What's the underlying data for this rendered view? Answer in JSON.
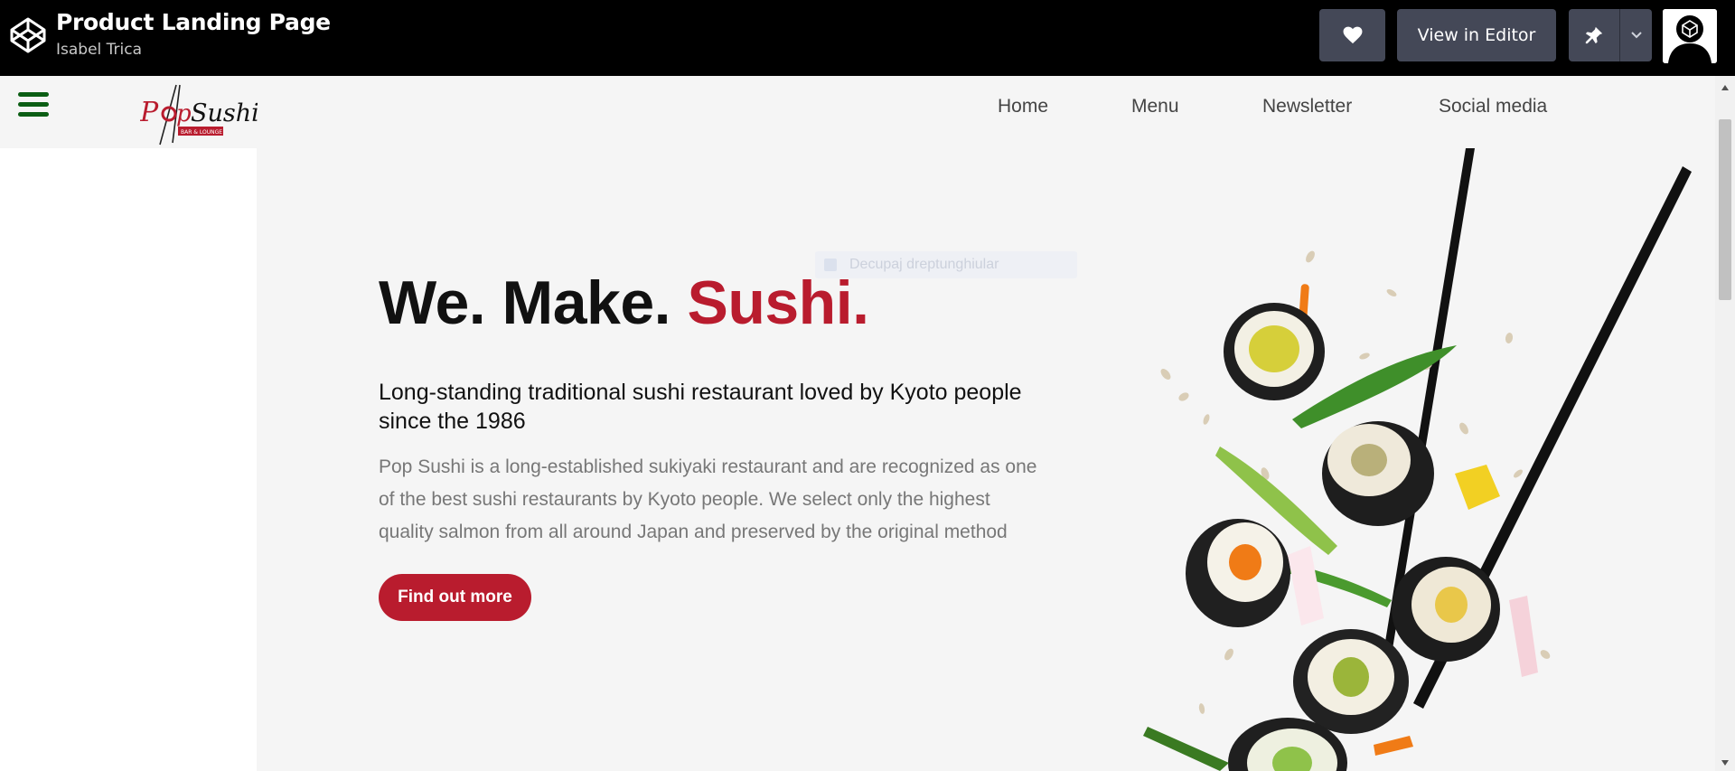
{
  "topbar": {
    "title": "Product Landing Page",
    "author": "Isabel Trica",
    "view_in_editor": "View in Editor",
    "icons": [
      "codepen-logo-icon",
      "heart-icon",
      "pin-icon",
      "chevron-down-icon",
      "avatar"
    ]
  },
  "nav": {
    "brand_icon": "pop-sushi-logo",
    "items": [
      "Home",
      "Menu",
      "Newsletter",
      "Social media"
    ]
  },
  "hero": {
    "headline_prefix": "We. Make.",
    "headline_accent": "Sushi.",
    "subhead": "Long-standing traditional sushi restaurant loved by Kyoto people since the 1986",
    "body": "Pop Sushi is a long-established sukiyaki restaurant and are recognized as one of the best sushi restaurants by Kyoto people. We select only the highest quality salmon from all around Japan and preserved by the original method",
    "cta": "Find out more"
  },
  "overlay": {
    "ghost_text": "Decupaj dreptunghiular"
  },
  "colors": {
    "accent": "#b91c2e",
    "hamburger": "#0b5e14",
    "topbar_bg": "#000000",
    "button_bg": "#444857",
    "page_bg": "#f5f5f5"
  }
}
